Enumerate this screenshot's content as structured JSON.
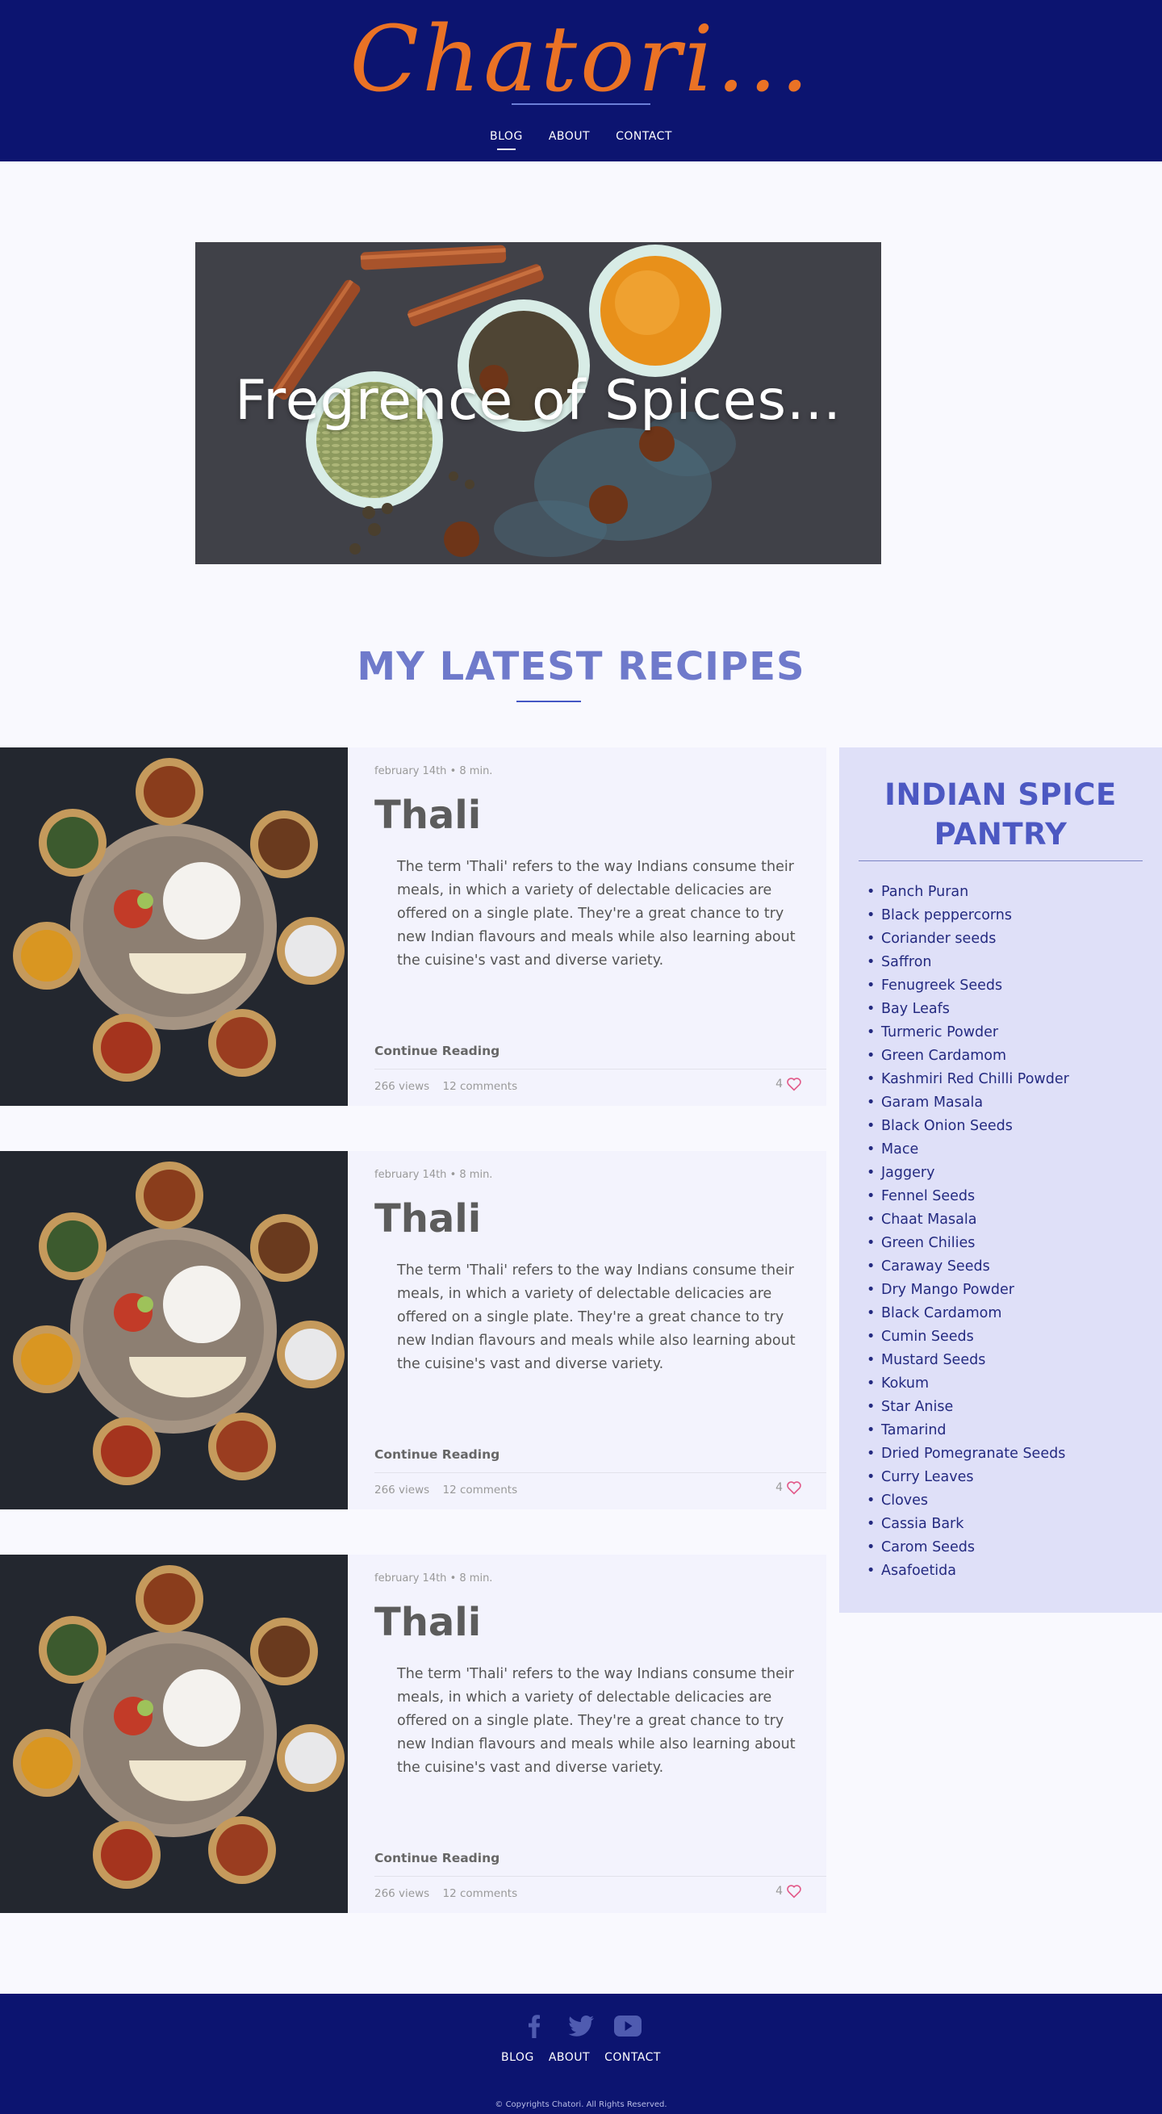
{
  "brand": {
    "logo_text": "Chatori...",
    "color": "#ea7225"
  },
  "nav": {
    "items": [
      "BLOG",
      "ABOUT",
      "CONTACT"
    ],
    "active": "BLOG"
  },
  "hero": {
    "title": "Fregrence of Spices..."
  },
  "section": {
    "title": "MY LATEST RECIPES"
  },
  "posts": [
    {
      "date": "february 14th",
      "read_time": "8 min.",
      "title": "Thali",
      "excerpt": "The term 'Thali' refers to the way Indians consume their meals, in which a variety of delectable delicacies are offered on a single plate. They're a great chance to try new Indian flavours and meals while also learning about the cuisine's vast and diverse variety.",
      "cta": "Continue Reading",
      "views": "266 views",
      "comments": "12 comments",
      "likes": "4"
    },
    {
      "date": "february 14th",
      "read_time": "8 min.",
      "title": "Thali",
      "excerpt": "The term 'Thali' refers to the way Indians consume their meals, in which a variety of delectable delicacies are offered on a single plate. They're a great chance to try new Indian flavours and meals while also learning about the cuisine's vast and diverse variety.",
      "cta": "Continue Reading",
      "views": "266 views",
      "comments": "12 comments",
      "likes": "4"
    },
    {
      "date": "february 14th",
      "read_time": "8 min.",
      "title": "Thali",
      "excerpt": "The term 'Thali' refers to the way Indians consume their meals, in which a variety of delectable delicacies are offered on a single plate. They're a great chance to try new Indian flavours and meals while also learning about the cuisine's vast and diverse variety.",
      "cta": "Continue Reading",
      "views": "266 views",
      "comments": "12 comments",
      "likes": "4"
    }
  ],
  "sidebar": {
    "title_line1": "INDIAN SPICE",
    "title_line2": "PANTRY",
    "items": [
      "Panch Puran",
      "Black peppercorns",
      "Coriander seeds",
      "Saffron",
      "Fenugreek Seeds",
      "Bay Leafs",
      "Turmeric Powder",
      "Green Cardamom",
      "Kashmiri Red Chilli Powder",
      "Garam Masala",
      "Black Onion Seeds",
      "Mace",
      "Jaggery",
      "Fennel Seeds",
      "Chaat Masala",
      "Green Chilies",
      "Caraway Seeds",
      "Dry Mango Powder",
      "Black Cardamom",
      "Cumin Seeds",
      "Mustard Seeds",
      "Kokum",
      "Star Anise",
      "Tamarind",
      "Dried Pomegranate Seeds",
      "Curry Leaves",
      "Cloves",
      "Cassia Bark",
      "Carom Seeds",
      "Asafoetida"
    ]
  },
  "footer": {
    "social_icons": [
      "facebook-icon",
      "twitter-icon",
      "youtube-icon"
    ],
    "nav": [
      "BLOG",
      "ABOUT",
      "CONTACT"
    ],
    "copyright": "Copyrights Chatori. All Rights Reserved."
  },
  "colors": {
    "header_bg": "#0c1470",
    "accent": "#6f7acb",
    "sidebar_bg": "#dfe0f8",
    "heart": "#e25a8a"
  }
}
